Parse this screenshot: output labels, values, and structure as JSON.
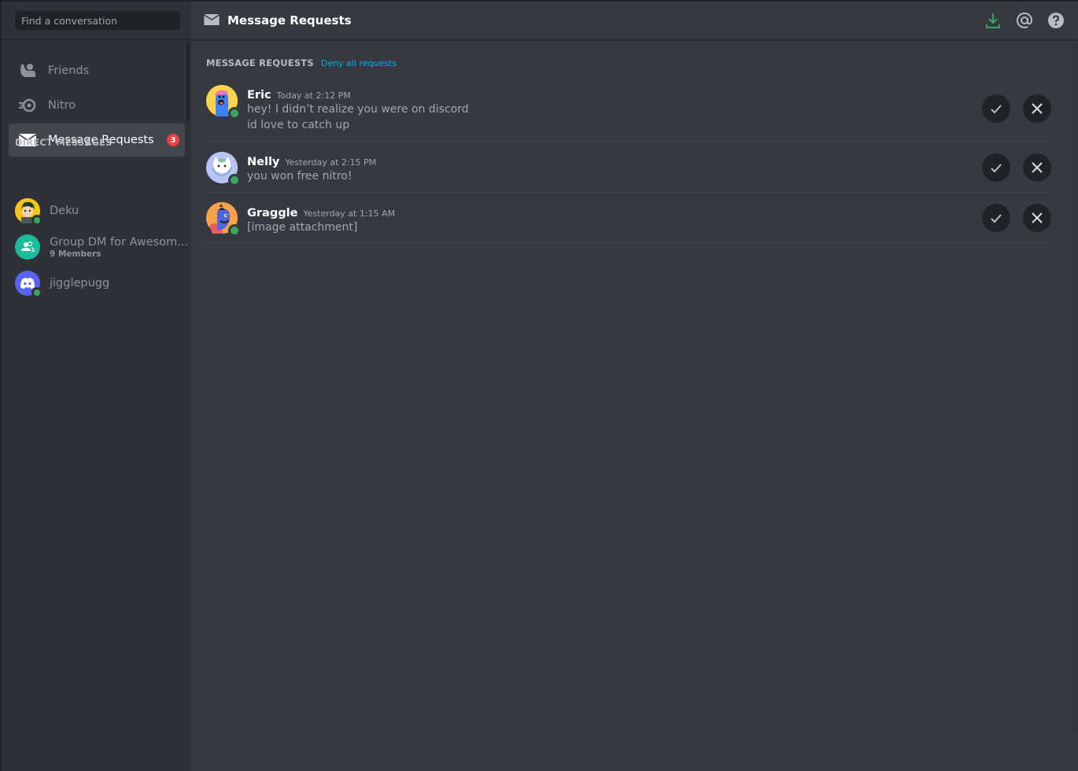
{
  "sidebar": {
    "search_placeholder": "Find a conversation",
    "nav": [
      {
        "label": "Friends",
        "icon": "friends-icon"
      },
      {
        "label": "Nitro",
        "icon": "nitro-icon"
      },
      {
        "label": "Message Requests",
        "icon": "envelope-icon",
        "badge": "3",
        "active": true
      }
    ],
    "dm_header": "DIRECT MESSAGES",
    "dms": [
      {
        "name": "Deku",
        "subtitle": "",
        "avatar_color": "#f5c518",
        "online": true
      },
      {
        "name": "Group DM for Awesom...",
        "subtitle": "9 Members",
        "avatar_color": "#1abc9c",
        "online": false
      },
      {
        "name": "jigglepugg",
        "subtitle": "",
        "avatar_color": "#5865f2",
        "online": true
      }
    ]
  },
  "header": {
    "title": "Message Requests",
    "icons": [
      "download-icon",
      "mention-icon",
      "help-icon"
    ]
  },
  "main": {
    "section_title": "MESSAGE REQUESTS",
    "deny_all_label": "Deny all requests",
    "requests": [
      {
        "name": "Eric",
        "time": "Today at 2:12 PM",
        "messages": [
          "hey! I didn’t realize you were on discord",
          "id love to catch up"
        ],
        "avatar_color": "#fbd34d",
        "online": true
      },
      {
        "name": "Nelly",
        "time": "Yesterday at 2:15 PM",
        "messages": [
          "you won free nitro!"
        ],
        "avatar_color": "#b8c4f5",
        "online": true
      },
      {
        "name": "Graggle",
        "time": "Yesterday at 1:15 AM",
        "messages": [
          "[image attachment]"
        ],
        "avatar_color": "#f7a24b",
        "online": true
      }
    ]
  },
  "colors": {
    "accent_link": "#00b0f4",
    "online": "#3ba55d",
    "badge": "#ed4245",
    "download": "#3ba55d"
  }
}
